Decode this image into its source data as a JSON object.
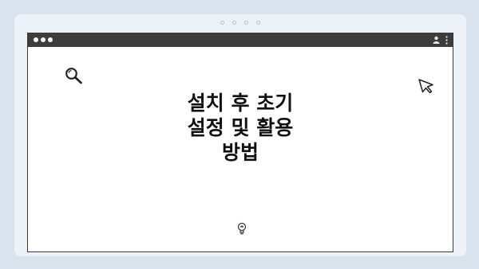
{
  "window": {
    "headline_lines": [
      "설치 후 초기",
      "설정 및 활용",
      "방법"
    ]
  },
  "icons": {
    "search": "search-icon",
    "cursor": "cursor-arrow-icon",
    "bulb": "lightbulb-icon",
    "profile": "profile-icon",
    "menu": "more-vert-icon"
  },
  "colors": {
    "background": "#d9e3ee",
    "stage": "#edf2f8",
    "titlebar": "#3d3d3d",
    "window": "#ffffff",
    "text": "#111111"
  }
}
